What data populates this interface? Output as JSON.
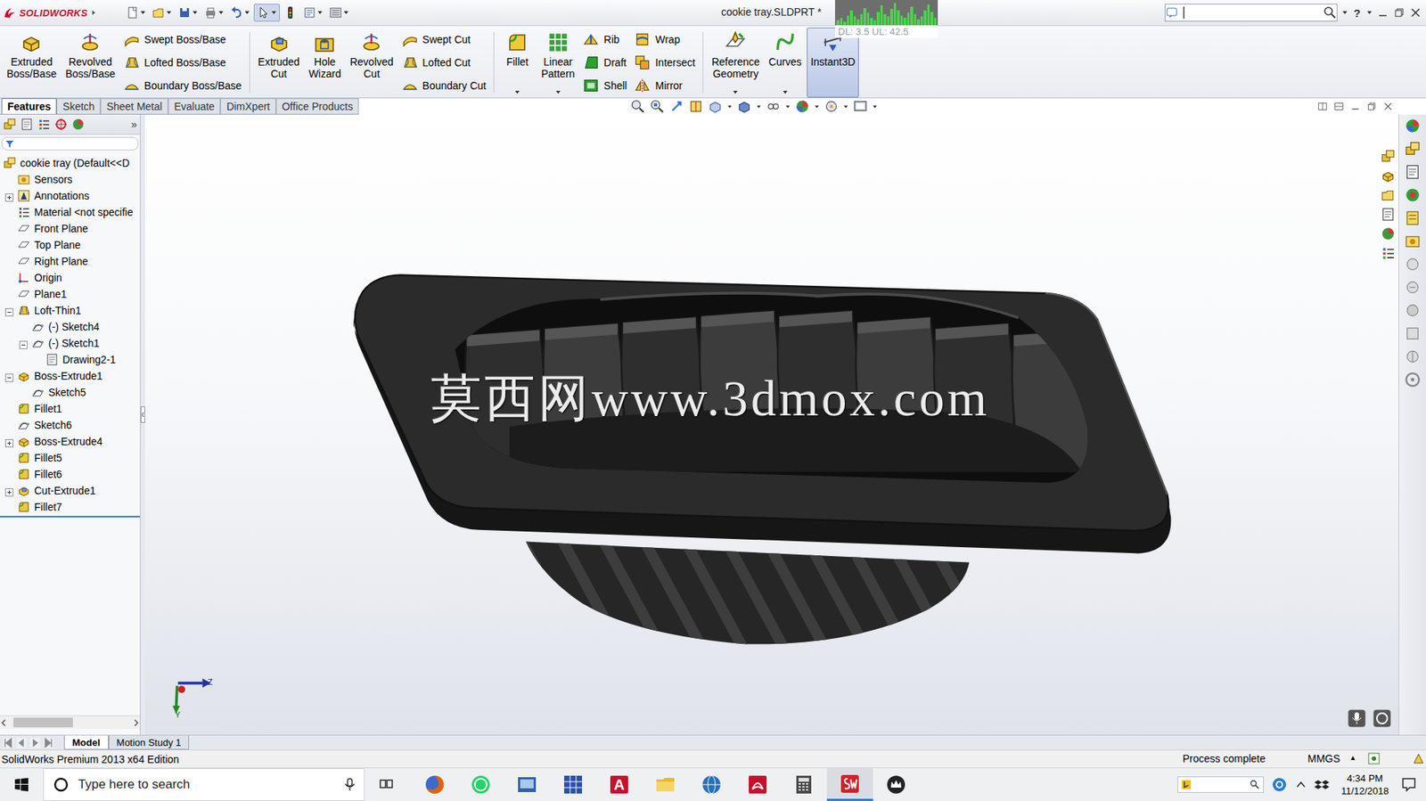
{
  "window": {
    "title": "cookie tray.SLDPRT *",
    "app": "SOLIDWORKS",
    "help_glyph": "?"
  },
  "perf": {
    "reading": "DL: 3.5 UL: 42.5",
    "values": [
      4,
      6,
      3,
      8,
      12,
      7,
      5,
      9,
      14,
      10,
      6,
      4,
      11,
      16,
      9,
      7,
      13,
      18,
      12,
      8,
      6,
      10,
      15,
      9,
      5,
      7,
      12,
      17,
      11,
      6
    ]
  },
  "ribbon": [
    {
      "kind": "big",
      "label": "Extruded Boss/Base",
      "selected": false,
      "menu": false
    },
    {
      "kind": "big",
      "label": "Revolved Boss/Base",
      "selected": false,
      "menu": false
    },
    {
      "kind": "stack",
      "items": [
        {
          "label": "Swept Boss/Base"
        },
        {
          "label": "Lofted Boss/Base"
        },
        {
          "label": "Boundary Boss/Base"
        }
      ]
    },
    {
      "kind": "separator"
    },
    {
      "kind": "big",
      "label": "Extruded Cut",
      "selected": false,
      "menu": false
    },
    {
      "kind": "big",
      "label": "Hole Wizard",
      "selected": false,
      "menu": false
    },
    {
      "kind": "big",
      "label": "Revolved Cut",
      "selected": false,
      "menu": false
    },
    {
      "kind": "stack",
      "items": [
        {
          "label": "Swept Cut"
        },
        {
          "label": "Lofted Cut"
        },
        {
          "label": "Boundary Cut"
        }
      ]
    },
    {
      "kind": "separator"
    },
    {
      "kind": "big",
      "label": "Fillet",
      "selected": false,
      "menu": true
    },
    {
      "kind": "big",
      "label": "Linear Pattern",
      "selected": false,
      "menu": true
    },
    {
      "kind": "stack",
      "items": [
        {
          "label": "Rib"
        },
        {
          "label": "Draft"
        },
        {
          "label": "Shell"
        }
      ]
    },
    {
      "kind": "stack",
      "items": [
        {
          "label": "Wrap"
        },
        {
          "label": "Intersect"
        },
        {
          "label": "Mirror"
        }
      ]
    },
    {
      "kind": "separator"
    },
    {
      "kind": "big",
      "label": "Reference Geometry",
      "selected": false,
      "menu": true
    },
    {
      "kind": "big",
      "label": "Curves",
      "selected": false,
      "menu": true
    },
    {
      "kind": "big",
      "label": "Instant3D",
      "selected": true,
      "menu": false
    }
  ],
  "command_tabs": [
    {
      "label": "Features",
      "selected": true
    },
    {
      "label": "Sketch",
      "selected": false
    },
    {
      "label": "Sheet Metal",
      "selected": false
    },
    {
      "label": "Evaluate",
      "selected": false
    },
    {
      "label": "DimXpert",
      "selected": false
    },
    {
      "label": "Office Products",
      "selected": false
    }
  ],
  "panel": {
    "overflow": "»"
  },
  "tree": [
    {
      "label": "cookie tray  (Default<<D",
      "level": 0,
      "kind": "part",
      "expandable": false,
      "expanded": false
    },
    {
      "label": "Sensors",
      "level": 1,
      "kind": "sensor",
      "expandable": false,
      "expanded": false
    },
    {
      "label": "Annotations",
      "level": 1,
      "kind": "annotation",
      "expandable": true,
      "expanded": false
    },
    {
      "label": "Material <not specifie",
      "level": 1,
      "kind": "material",
      "expandable": false,
      "expanded": false
    },
    {
      "label": "Front Plane",
      "level": 1,
      "kind": "plane",
      "expandable": false,
      "expanded": false
    },
    {
      "label": "Top Plane",
      "level": 1,
      "kind": "plane",
      "expandable": false,
      "expanded": false
    },
    {
      "label": "Right Plane",
      "level": 1,
      "kind": "plane",
      "expandable": false,
      "expanded": false
    },
    {
      "label": "Origin",
      "level": 1,
      "kind": "origin",
      "expandable": false,
      "expanded": false
    },
    {
      "label": "Plane1",
      "level": 1,
      "kind": "plane",
      "expandable": false,
      "expanded": false
    },
    {
      "label": "Loft-Thin1",
      "level": 1,
      "kind": "loft",
      "expandable": true,
      "expanded": true
    },
    {
      "label": "(-) Sketch4",
      "level": 2,
      "kind": "sketch",
      "expandable": false,
      "expanded": false
    },
    {
      "label": "(-) Sketch1",
      "level": 2,
      "kind": "sketch",
      "expandable": true,
      "expanded": true
    },
    {
      "label": "Drawing2-1",
      "level": 3,
      "kind": "drawing",
      "expandable": false,
      "expanded": false
    },
    {
      "label": "Boss-Extrude1",
      "level": 1,
      "kind": "extrude",
      "expandable": true,
      "expanded": true
    },
    {
      "label": "Sketch5",
      "level": 2,
      "kind": "sketch",
      "expandable": false,
      "expanded": false
    },
    {
      "label": "Fillet1",
      "level": 1,
      "kind": "fillet",
      "expandable": false,
      "expanded": false
    },
    {
      "label": "Sketch6",
      "level": 1,
      "kind": "sketch",
      "expandable": false,
      "expanded": false
    },
    {
      "label": "Boss-Extrude4",
      "level": 1,
      "kind": "extrude",
      "expandable": true,
      "expanded": false
    },
    {
      "label": "Fillet5",
      "level": 1,
      "kind": "fillet",
      "expandable": false,
      "expanded": false
    },
    {
      "label": "Fillet6",
      "level": 1,
      "kind": "fillet",
      "expandable": false,
      "expanded": false
    },
    {
      "label": "Cut-Extrude1",
      "level": 1,
      "kind": "cut",
      "expandable": true,
      "expanded": false
    },
    {
      "label": "Fillet7",
      "level": 1,
      "kind": "fillet",
      "expandable": false,
      "expanded": false
    }
  ],
  "watermark": "莫西网www.3dmox.com",
  "triad": {
    "z": "Z",
    "y": "Y"
  },
  "bottom_tabs": [
    {
      "label": "Model",
      "selected": true
    },
    {
      "label": "Motion Study 1",
      "selected": false
    }
  ],
  "status_bar": {
    "edition": "SolidWorks Premium 2013 x64 Edition",
    "message": "Process complete",
    "units": "MMGS",
    "units_arrow": "▴"
  },
  "taskbar": {
    "search_placeholder": "Type here to search",
    "apps": [
      {
        "kind": "firefox",
        "active": false,
        "color": "#e66000"
      },
      {
        "kind": "whatsapp",
        "active": false,
        "color": "#25d366"
      },
      {
        "kind": "viewer",
        "active": false,
        "color": "#3a5ea8"
      },
      {
        "kind": "grid",
        "active": false,
        "color": "#2b4fa8"
      },
      {
        "kind": "letter",
        "glyph": "A",
        "active": false,
        "color": "#c8102e"
      },
      {
        "kind": "folder",
        "active": false,
        "color": "#e8b830"
      },
      {
        "kind": "globe",
        "active": false,
        "color": "#2a6fb8"
      },
      {
        "kind": "acrobat",
        "active": false,
        "color": "#c8102e"
      },
      {
        "kind": "calculator",
        "active": false,
        "color": "#4a4a4a"
      },
      {
        "kind": "solidworks",
        "active": true,
        "color": "#d0222a"
      },
      {
        "kind": "crown",
        "active": false,
        "color": "#222222"
      }
    ],
    "time": "4:34 PM",
    "date": "11/12/2018"
  }
}
